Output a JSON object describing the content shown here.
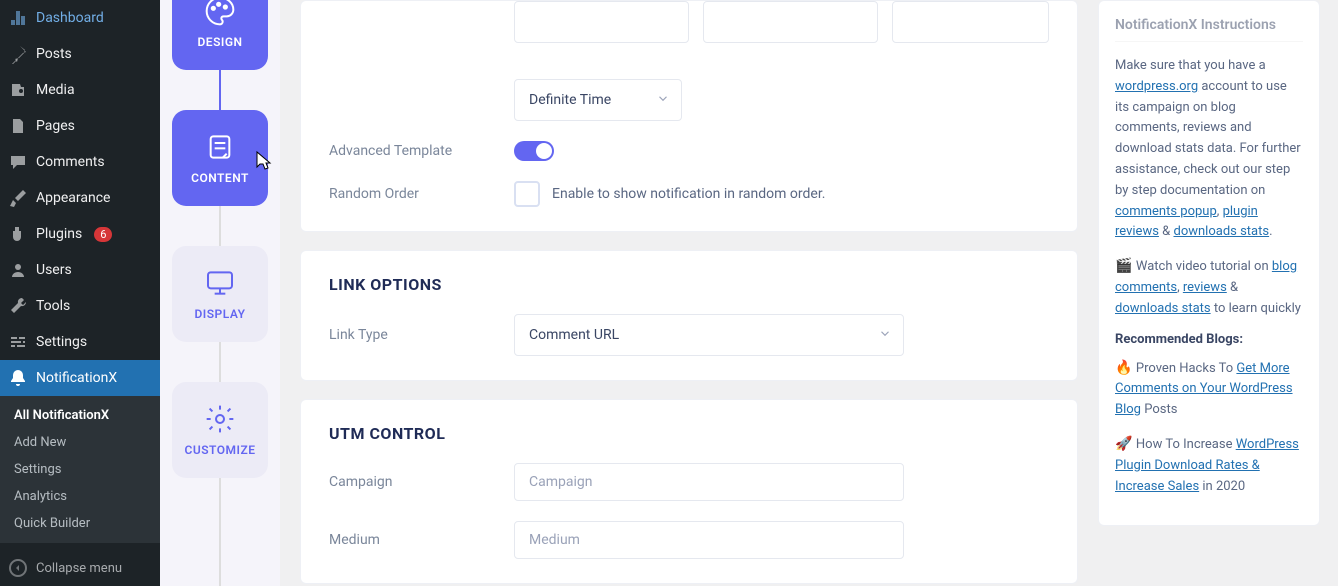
{
  "wp_sidebar": {
    "items": [
      {
        "id": "dashboard",
        "label": "Dashboard"
      },
      {
        "id": "posts",
        "label": "Posts"
      },
      {
        "id": "media",
        "label": "Media"
      },
      {
        "id": "pages",
        "label": "Pages"
      },
      {
        "id": "comments",
        "label": "Comments"
      },
      {
        "id": "appearance",
        "label": "Appearance"
      },
      {
        "id": "plugins",
        "label": "Plugins",
        "badge": "6"
      },
      {
        "id": "users",
        "label": "Users"
      },
      {
        "id": "tools",
        "label": "Tools"
      },
      {
        "id": "settings",
        "label": "Settings"
      },
      {
        "id": "notificationx",
        "label": "NotificationX"
      }
    ],
    "submenu": [
      {
        "label": "All NotificationX",
        "current": true
      },
      {
        "label": "Add New"
      },
      {
        "label": "Settings"
      },
      {
        "label": "Analytics"
      },
      {
        "label": "Quick Builder"
      }
    ],
    "collapse": "Collapse menu"
  },
  "steps": [
    {
      "id": "design",
      "label": "DESIGN",
      "active": true
    },
    {
      "id": "content",
      "label": "CONTENT",
      "active": true
    },
    {
      "id": "display",
      "label": "DISPLAY",
      "active": false
    },
    {
      "id": "customize",
      "label": "CUSTOMIZE",
      "active": false
    }
  ],
  "form": {
    "definite_time": "Definite Time",
    "advanced_template_label": "Advanced Template",
    "random_order_label": "Random Order",
    "random_order_help": "Enable to show notification in random order.",
    "link_options_title": "LINK OPTIONS",
    "link_type_label": "Link Type",
    "link_type_value": "Comment URL",
    "utm_title": "UTM CONTROL",
    "campaign_label": "Campaign",
    "campaign_placeholder": "Campaign",
    "medium_label": "Medium",
    "medium_placeholder": "Medium"
  },
  "info": {
    "title_partial": "NotificationX Instructions",
    "p1_pre": "Make sure that you have a ",
    "p1_link1": "wordpress.org",
    "p1_mid": " account to use its campaign on blog comments, reviews and download stats data. For further assistance, check out our step by step documentation on ",
    "p1_link2": "comments popup",
    "p1_sep1": ", ",
    "p1_link3": "plugin reviews",
    "p1_sep2": " & ",
    "p1_link4": "downloads stats",
    "p1_end": ".",
    "p2_pre": "Watch video tutorial on ",
    "p2_link1": "blog comments",
    "p2_sep1": ", ",
    "p2_link2": "reviews",
    "p2_sep2": " & ",
    "p2_link3": "downloads stats",
    "p2_end": " to learn quickly",
    "rec_title": "Recommended Blogs:",
    "b1_pre": "Proven Hacks To ",
    "b1_link": "Get More Comments on Your WordPress Blog",
    "b1_end": " Posts",
    "b2_pre": "How To Increase ",
    "b2_link": "WordPress Plugin Download Rates & Increase Sales",
    "b2_end": " in 2020"
  }
}
